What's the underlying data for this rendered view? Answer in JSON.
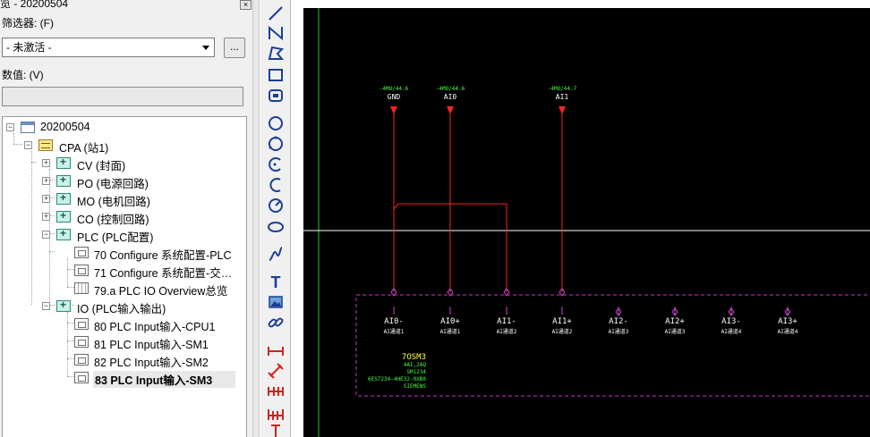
{
  "panel": {
    "title": "览 - 20200504",
    "close_icon": "close-icon",
    "filter_label": "筛选器: (F)",
    "filter_value": "- 未激活 -",
    "more_label": "...",
    "value_label": "数值: (V)",
    "value_input": ""
  },
  "tree": {
    "root": "20200504",
    "site": "CPA (站1)",
    "folders": [
      {
        "label": "CV (封面)"
      },
      {
        "label": "PO (电源回路)"
      },
      {
        "label": "MO (电机回路)"
      },
      {
        "label": "CO (控制回路)"
      },
      {
        "label": "PLC (PLC配置)"
      }
    ],
    "plc_pages": [
      {
        "label": "70 Configure 系统配置-PLC"
      },
      {
        "label": "71 Configure 系统配置-交…"
      },
      {
        "label": "79.a PLC IO Overview总览"
      }
    ],
    "io_folder": "IO (PLC输入输出)",
    "io_pages": [
      {
        "label": "80 PLC Input输入-CPU1"
      },
      {
        "label": "81 PLC Input输入-SM1"
      },
      {
        "label": "82 PLC Input输入-SM2"
      },
      {
        "label": "83 PLC Input输入-SM3"
      }
    ]
  },
  "toolbar": {
    "tools": [
      "line-icon",
      "polyline-icon",
      "polygon-icon",
      "rectangle-icon",
      "rounded-rect-icon",
      "circle-icon",
      "circle-3pt-icon",
      "arc-icon",
      "arc-alt-icon",
      "sector-icon",
      "ellipse-icon",
      "spline-icon",
      "text-icon",
      "image-icon",
      "link-icon",
      "dimension-h-icon",
      "dimension-aligned-icon",
      "dimension-chain-icon",
      "dimension-base-icon",
      "dimension-v-icon"
    ]
  },
  "schematic": {
    "signals_top": [
      {
        "ref": "-4MO/44.6",
        "name": "GND"
      },
      {
        "ref": "-4MO/44.6",
        "name": "AI0"
      },
      {
        "ref": "-4MO/44.7",
        "name": "AI1"
      }
    ],
    "terminals": [
      {
        "name": "AI0-",
        "desc": "AI通道1"
      },
      {
        "name": "AI0+",
        "desc": "AI通道1"
      },
      {
        "name": "AI1-",
        "desc": "AI通道2"
      },
      {
        "name": "AI1+",
        "desc": "AI通道2"
      },
      {
        "name": "AI2-",
        "desc": "AI通道3"
      },
      {
        "name": "AI2+",
        "desc": "AI通道3"
      },
      {
        "name": "AI3-",
        "desc": "AI通道4"
      },
      {
        "name": "AI3+",
        "desc": "AI通道4"
      }
    ],
    "module": {
      "tag": "7OSM3",
      "lines": [
        "4AI,2AQ",
        "SM1234",
        "6ES7234-4HE32-0XB0",
        "SIEMENS"
      ]
    },
    "colors": {
      "background": "#000000",
      "wire": "#ff2222",
      "terminal": "#cc44cc",
      "frame": "#cc33cc",
      "module_tag": "#ffff33",
      "module_text": "#44ff44",
      "signal_ref": "#44ff44",
      "crosshair": "#ffffff",
      "border_green": "#22cc22"
    }
  }
}
